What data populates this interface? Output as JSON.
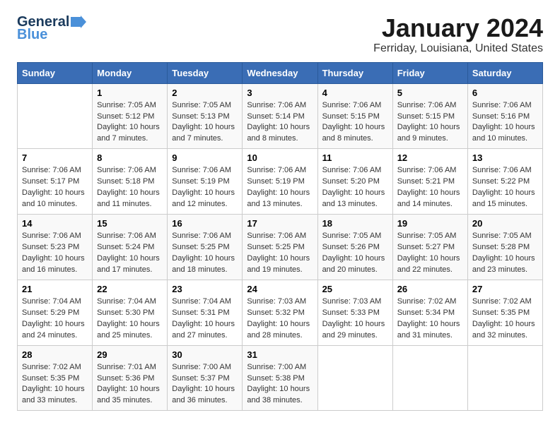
{
  "logo": {
    "line1": "General",
    "line2": "Blue"
  },
  "title": "January 2024",
  "location": "Ferriday, Louisiana, United States",
  "weekdays": [
    "Sunday",
    "Monday",
    "Tuesday",
    "Wednesday",
    "Thursday",
    "Friday",
    "Saturday"
  ],
  "weeks": [
    [
      {
        "day": "",
        "info": ""
      },
      {
        "day": "1",
        "info": "Sunrise: 7:05 AM\nSunset: 5:12 PM\nDaylight: 10 hours\nand 7 minutes."
      },
      {
        "day": "2",
        "info": "Sunrise: 7:05 AM\nSunset: 5:13 PM\nDaylight: 10 hours\nand 7 minutes."
      },
      {
        "day": "3",
        "info": "Sunrise: 7:06 AM\nSunset: 5:14 PM\nDaylight: 10 hours\nand 8 minutes."
      },
      {
        "day": "4",
        "info": "Sunrise: 7:06 AM\nSunset: 5:15 PM\nDaylight: 10 hours\nand 8 minutes."
      },
      {
        "day": "5",
        "info": "Sunrise: 7:06 AM\nSunset: 5:15 PM\nDaylight: 10 hours\nand 9 minutes."
      },
      {
        "day": "6",
        "info": "Sunrise: 7:06 AM\nSunset: 5:16 PM\nDaylight: 10 hours\nand 10 minutes."
      }
    ],
    [
      {
        "day": "7",
        "info": "Sunrise: 7:06 AM\nSunset: 5:17 PM\nDaylight: 10 hours\nand 10 minutes."
      },
      {
        "day": "8",
        "info": "Sunrise: 7:06 AM\nSunset: 5:18 PM\nDaylight: 10 hours\nand 11 minutes."
      },
      {
        "day": "9",
        "info": "Sunrise: 7:06 AM\nSunset: 5:19 PM\nDaylight: 10 hours\nand 12 minutes."
      },
      {
        "day": "10",
        "info": "Sunrise: 7:06 AM\nSunset: 5:19 PM\nDaylight: 10 hours\nand 13 minutes."
      },
      {
        "day": "11",
        "info": "Sunrise: 7:06 AM\nSunset: 5:20 PM\nDaylight: 10 hours\nand 13 minutes."
      },
      {
        "day": "12",
        "info": "Sunrise: 7:06 AM\nSunset: 5:21 PM\nDaylight: 10 hours\nand 14 minutes."
      },
      {
        "day": "13",
        "info": "Sunrise: 7:06 AM\nSunset: 5:22 PM\nDaylight: 10 hours\nand 15 minutes."
      }
    ],
    [
      {
        "day": "14",
        "info": "Sunrise: 7:06 AM\nSunset: 5:23 PM\nDaylight: 10 hours\nand 16 minutes."
      },
      {
        "day": "15",
        "info": "Sunrise: 7:06 AM\nSunset: 5:24 PM\nDaylight: 10 hours\nand 17 minutes."
      },
      {
        "day": "16",
        "info": "Sunrise: 7:06 AM\nSunset: 5:25 PM\nDaylight: 10 hours\nand 18 minutes."
      },
      {
        "day": "17",
        "info": "Sunrise: 7:06 AM\nSunset: 5:25 PM\nDaylight: 10 hours\nand 19 minutes."
      },
      {
        "day": "18",
        "info": "Sunrise: 7:05 AM\nSunset: 5:26 PM\nDaylight: 10 hours\nand 20 minutes."
      },
      {
        "day": "19",
        "info": "Sunrise: 7:05 AM\nSunset: 5:27 PM\nDaylight: 10 hours\nand 22 minutes."
      },
      {
        "day": "20",
        "info": "Sunrise: 7:05 AM\nSunset: 5:28 PM\nDaylight: 10 hours\nand 23 minutes."
      }
    ],
    [
      {
        "day": "21",
        "info": "Sunrise: 7:04 AM\nSunset: 5:29 PM\nDaylight: 10 hours\nand 24 minutes."
      },
      {
        "day": "22",
        "info": "Sunrise: 7:04 AM\nSunset: 5:30 PM\nDaylight: 10 hours\nand 25 minutes."
      },
      {
        "day": "23",
        "info": "Sunrise: 7:04 AM\nSunset: 5:31 PM\nDaylight: 10 hours\nand 27 minutes."
      },
      {
        "day": "24",
        "info": "Sunrise: 7:03 AM\nSunset: 5:32 PM\nDaylight: 10 hours\nand 28 minutes."
      },
      {
        "day": "25",
        "info": "Sunrise: 7:03 AM\nSunset: 5:33 PM\nDaylight: 10 hours\nand 29 minutes."
      },
      {
        "day": "26",
        "info": "Sunrise: 7:02 AM\nSunset: 5:34 PM\nDaylight: 10 hours\nand 31 minutes."
      },
      {
        "day": "27",
        "info": "Sunrise: 7:02 AM\nSunset: 5:35 PM\nDaylight: 10 hours\nand 32 minutes."
      }
    ],
    [
      {
        "day": "28",
        "info": "Sunrise: 7:02 AM\nSunset: 5:35 PM\nDaylight: 10 hours\nand 33 minutes."
      },
      {
        "day": "29",
        "info": "Sunrise: 7:01 AM\nSunset: 5:36 PM\nDaylight: 10 hours\nand 35 minutes."
      },
      {
        "day": "30",
        "info": "Sunrise: 7:00 AM\nSunset: 5:37 PM\nDaylight: 10 hours\nand 36 minutes."
      },
      {
        "day": "31",
        "info": "Sunrise: 7:00 AM\nSunset: 5:38 PM\nDaylight: 10 hours\nand 38 minutes."
      },
      {
        "day": "",
        "info": ""
      },
      {
        "day": "",
        "info": ""
      },
      {
        "day": "",
        "info": ""
      }
    ]
  ]
}
